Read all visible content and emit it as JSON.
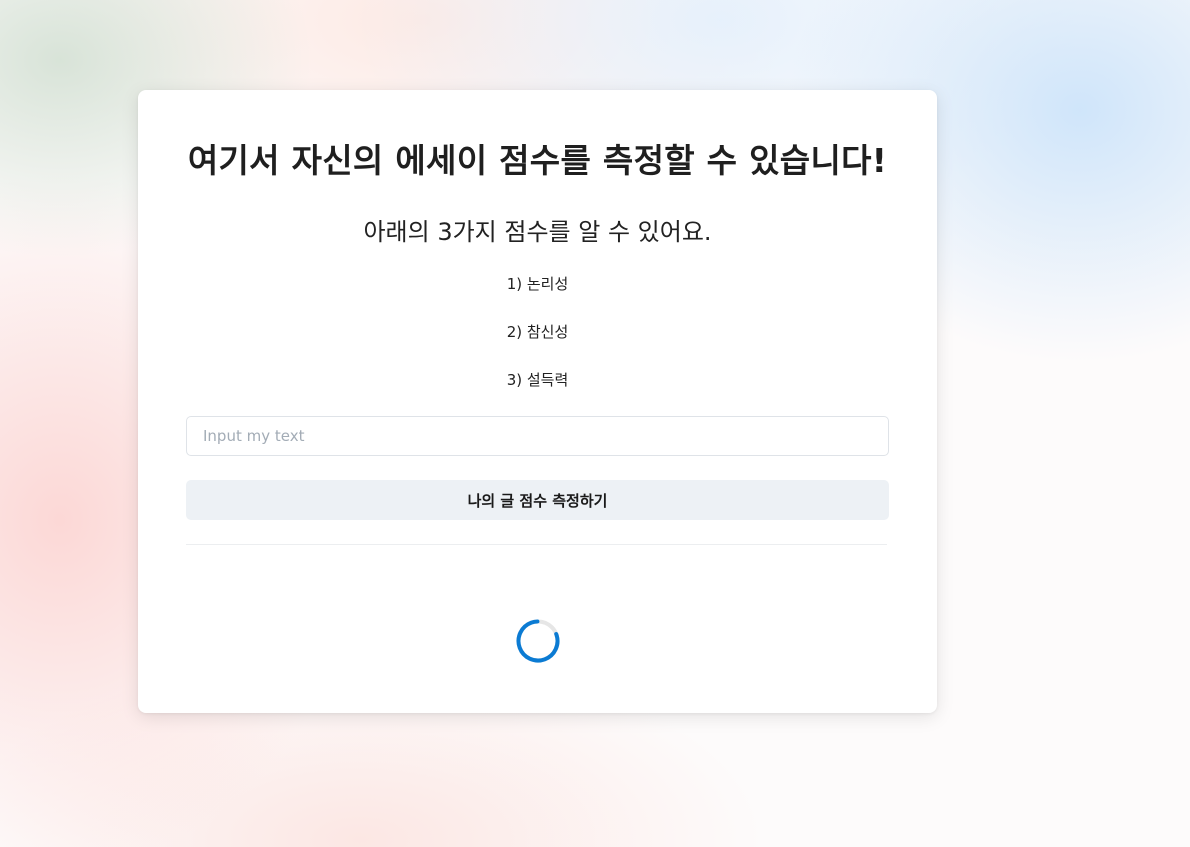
{
  "card": {
    "title": "여기서 자신의 에세이 점수를 측정할 수 있습니다!",
    "subtitle": "아래의 3가지 점수를 알 수 있어요.",
    "criteria": [
      "1) 논리성",
      "2) 참신성",
      "3) 설득력"
    ],
    "input": {
      "placeholder": "Input my text",
      "value": ""
    },
    "submit_label": "나의 글 점수 측정하기",
    "spinner": {
      "state": "loading",
      "color": "#0b7bd3",
      "track_color": "#e6e6e6"
    }
  }
}
